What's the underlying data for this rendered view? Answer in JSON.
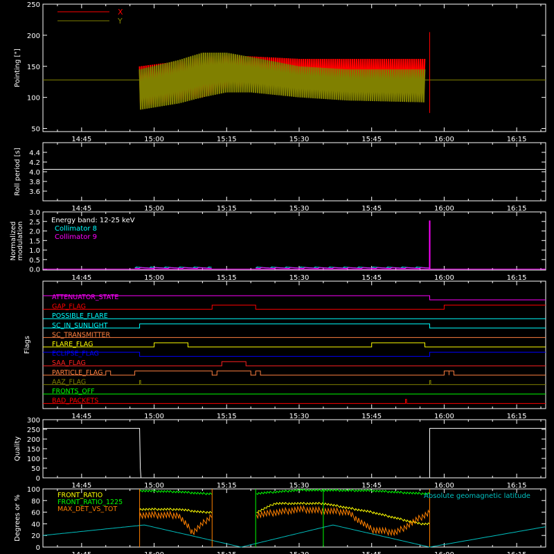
{
  "time_ticks": [
    "14:45",
    "15:00",
    "15:15",
    "15:30",
    "15:45",
    "16:00",
    "16:15"
  ],
  "chart_data": [
    {
      "type": "line",
      "panel": "pointing",
      "ylabel": "Pointing [\"]",
      "ylim": [
        45,
        250
      ],
      "yticks": [
        50,
        100,
        150,
        200,
        250
      ],
      "x_units": "time (HH:MM)",
      "series": [
        {
          "name": "X",
          "color": "#ff0000",
          "band": {
            "x": [
              "14:57",
              "15:05",
              "15:10",
              "15:15",
              "15:20",
              "15:30",
              "15:40",
              "15:56"
            ],
            "upper": [
              150,
              158,
              165,
              168,
              166,
              162,
              162,
              162
            ],
            "lower": [
              85,
              95,
              100,
              115,
              118,
              115,
              108,
              102
            ]
          }
        },
        {
          "name": "Y",
          "color": "#808000",
          "band": {
            "x": [
              "14:57",
              "15:05",
              "15:10",
              "15:15",
              "15:20",
              "15:30",
              "15:40",
              "15:56"
            ],
            "upper": [
              145,
              160,
              172,
              172,
              165,
              150,
              145,
              145
            ],
            "lower": [
              80,
              90,
              100,
              108,
              108,
              100,
              95,
              92
            ]
          }
        }
      ],
      "reference_level": 128,
      "spike": {
        "x": "15:57",
        "y_max": 205,
        "y_min": 75
      },
      "legend": "top-left"
    },
    {
      "type": "line",
      "panel": "roll",
      "ylabel": "Roll period [s]",
      "ylim": [
        3.4,
        4.6
      ],
      "yticks": [
        "3.6",
        "3.8",
        "4.0",
        "4.2",
        "4.4"
      ],
      "series": [
        {
          "color": "#ffffff",
          "x": [
            "14:37",
            "16:21"
          ],
          "y": [
            4.05,
            4.05
          ]
        }
      ]
    },
    {
      "type": "line",
      "panel": "modulation",
      "ylabel": "Normalized modulation",
      "ylim": [
        -0.05,
        3.0
      ],
      "yticks": [
        "0.0",
        "0.5",
        "1.0",
        "1.5",
        "2.0",
        "2.5",
        "3.0"
      ],
      "annotation": "Energy band: 12-25 keV",
      "series": [
        {
          "name": "Collimator 8",
          "color": "#00ffff",
          "segments": [
            [
              "14:56",
              "15:12",
              0.08
            ],
            [
              "15:21",
              "15:57",
              0.08
            ]
          ]
        },
        {
          "name": "Collimator 9",
          "color": "#ff00ff",
          "segments": [
            [
              "14:56",
              "15:12",
              0.06
            ],
            [
              "15:21",
              "15:57",
              0.06
            ]
          ]
        }
      ],
      "spike": {
        "x": "15:57",
        "y": 2.55
      },
      "legend": "top-left"
    },
    {
      "type": "line",
      "panel": "flags",
      "ylabel": "Flags",
      "flags": [
        {
          "label": "ATTENUATOR_STATE",
          "color": "#ff00ff",
          "on": [
            [
              "14:37",
              "15:57"
            ]
          ]
        },
        {
          "label": "GAP_FLAG",
          "color": "#ff0000",
          "on": [
            [
              "15:12",
              "15:21"
            ],
            [
              "16:00",
              "16:21"
            ]
          ]
        },
        {
          "label": "POSSIBLE_FLARE",
          "color": "#00ffff",
          "on": []
        },
        {
          "label": "SC_IN_SUNLIGHT",
          "color": "#00ffff",
          "on": [
            [
              "14:57",
              "15:57"
            ]
          ]
        },
        {
          "label": "SC_TRANSMITTER",
          "color": "#ff8040",
          "on": []
        },
        {
          "label": "FLARE_FLAG",
          "color": "#ffff00",
          "on": [
            [
              "15:00",
              "15:07"
            ],
            [
              "15:45",
              "15:56"
            ]
          ]
        },
        {
          "label": "ECLIPSE_FLAG",
          "color": "#0000ff",
          "on": [
            [
              "14:37",
              "14:57"
            ],
            [
              "15:57",
              "16:21"
            ]
          ]
        },
        {
          "label": "SAA_FLAG",
          "color": "#ff2020",
          "on": [
            [
              "15:14",
              "15:19"
            ]
          ]
        },
        {
          "label": "PARTICLE_FLAG",
          "color": "#ff8040",
          "on": [
            [
              "14:50",
              "14:51"
            ],
            [
              "14:56",
              "15:12"
            ],
            [
              "15:13",
              "15:20"
            ],
            [
              "15:21",
              "15:22"
            ],
            [
              "16:00",
              "16:01"
            ],
            [
              "16:01",
              "16:02"
            ]
          ]
        },
        {
          "label": "AAZ_FLAG",
          "color": "#808000",
          "on": [
            [
              "14:57",
              "14:57"
            ],
            [
              "15:57",
              "15:57"
            ]
          ]
        },
        {
          "label": "FRONTS_OFF",
          "color": "#00ff00",
          "on": []
        },
        {
          "label": "BAD_PACKETS",
          "color": "#ff0000",
          "on": [
            [
              "15:52",
              "15:52"
            ]
          ]
        }
      ]
    },
    {
      "type": "line",
      "panel": "quality",
      "ylabel": "Quality",
      "ylim": [
        0,
        300
      ],
      "yticks": [
        "0",
        "50",
        "100",
        "150",
        "200",
        "250",
        "300"
      ],
      "series": [
        {
          "color": "#ffffff",
          "x": [
            "14:37",
            "14:57",
            "14:57",
            "14:57",
            "15:57",
            "15:57",
            "16:21"
          ],
          "y": [
            255,
            255,
            50,
            0,
            0,
            255,
            255
          ]
        }
      ]
    },
    {
      "type": "line",
      "panel": "ratios",
      "ylabel": "Degrees or %",
      "ylim": [
        0,
        100
      ],
      "yticks": [
        "0",
        "20",
        "40",
        "60",
        "80",
        "100"
      ],
      "annotation": "Absolute geomagnetic latitude",
      "series": [
        {
          "name": "FRONT_RATIO",
          "color": "#ffff00",
          "x": [
            "14:57",
            "15:05",
            "15:10",
            "15:15",
            "15:20",
            "15:25",
            "15:35",
            "15:45",
            "15:55",
            "15:57"
          ],
          "y": [
            65,
            65,
            60,
            60,
            55,
            75,
            75,
            60,
            40,
            40
          ]
        },
        {
          "name": "FRONT_RATIO_1225",
          "color": "#00ff00",
          "x": [
            "14:57",
            "15:05",
            "15:10",
            "15:12",
            "15:21",
            "15:30",
            "15:45",
            "15:55",
            "15:57"
          ],
          "y": [
            97,
            95,
            92,
            92,
            92,
            98,
            97,
            92,
            92
          ]
        },
        {
          "name": "MAX_DET_VS_TOT",
          "color": "#ff8000",
          "x": [
            "14:57",
            "15:05",
            "15:08",
            "15:12",
            "15:21",
            "15:30",
            "15:40",
            "15:45",
            "15:50",
            "15:55",
            "15:57"
          ],
          "y": [
            55,
            55,
            25,
            55,
            55,
            65,
            60,
            30,
            25,
            50,
            60
          ]
        },
        {
          "name": "Absolute geomagnetic latitude",
          "color": "#00c0c0",
          "x": [
            "14:37",
            "14:58",
            "15:18",
            "15:37",
            "15:57",
            "16:21"
          ],
          "y": [
            20,
            38,
            0,
            38,
            0,
            35
          ]
        }
      ],
      "legend": "top-left"
    }
  ]
}
